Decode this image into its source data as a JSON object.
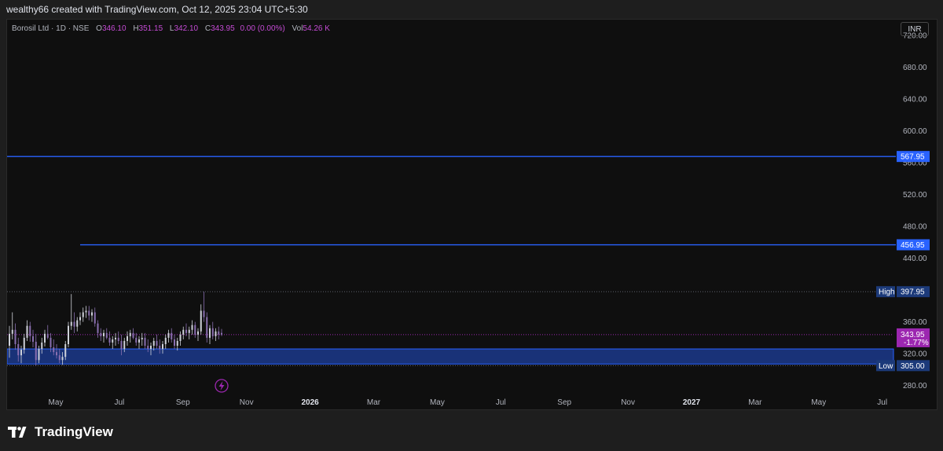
{
  "caption": "wealthy66 created with TradingView.com, Oct 12, 2025 23:04 UTC+5:30",
  "legend": {
    "symbol": "Borosil Ltd · 1D · NSE",
    "open_label": "O",
    "open": "346.10",
    "high_label": "H",
    "high": "351.15",
    "low_label": "L",
    "low": "342.10",
    "close_label": "C",
    "close": "343.95",
    "change": "0.00 (0.00%)",
    "vol_label": "Vol",
    "vol": "54.26 K"
  },
  "currency": "INR",
  "brand": "TradingView",
  "colors": {
    "accent_blue": "#2962ff",
    "purple": "#9c27b0",
    "label_navy": "#1c3a7a",
    "zone_fill": "#1d3f9c"
  },
  "chart_data": {
    "type": "candlestick",
    "ylim": [
      250,
      740
    ],
    "y_ticks": [
      720,
      680,
      640,
      600,
      560,
      520,
      480,
      440,
      360,
      320,
      280
    ],
    "y_tick_labels": [
      "720.00",
      "680.00",
      "640.00",
      "600.00",
      "560.00",
      "520.00",
      "480.00",
      "440.00",
      "360.00",
      "320.00",
      "280.00"
    ],
    "x_ticks": [
      {
        "label": "May",
        "year": false
      },
      {
        "label": "Jul",
        "year": false
      },
      {
        "label": "Sep",
        "year": false
      },
      {
        "label": "Nov",
        "year": false
      },
      {
        "label": "2026",
        "year": true
      },
      {
        "label": "Mar",
        "year": false
      },
      {
        "label": "May",
        "year": false
      },
      {
        "label": "Jul",
        "year": false
      },
      {
        "label": "Sep",
        "year": false
      },
      {
        "label": "Nov",
        "year": false
      },
      {
        "label": "2027",
        "year": true
      },
      {
        "label": "Mar",
        "year": false
      },
      {
        "label": "May",
        "year": false
      },
      {
        "label": "Jul",
        "year": false
      }
    ],
    "horizontal_lines": [
      {
        "value": 567.95,
        "label": "567.95",
        "extends_from_start": true
      },
      {
        "value": 456.95,
        "label": "456.95",
        "extends_from_start": false
      }
    ],
    "high": {
      "label": "High",
      "value": "397.95",
      "y": 397.95
    },
    "low": {
      "label": "Low",
      "value": "305.00",
      "y": 305.0
    },
    "last_price": {
      "value": "343.95",
      "change": "-1.77%",
      "y": 343.95
    },
    "support_zone": [
      307,
      326
    ],
    "candles": [
      [
        330,
        355,
        315,
        345
      ],
      [
        345,
        372,
        338,
        350
      ],
      [
        350,
        358,
        325,
        332
      ],
      [
        332,
        340,
        310,
        318
      ],
      [
        318,
        330,
        308,
        325
      ],
      [
        325,
        345,
        320,
        340
      ],
      [
        340,
        362,
        336,
        355
      ],
      [
        355,
        360,
        335,
        342
      ],
      [
        342,
        350,
        328,
        335
      ],
      [
        335,
        345,
        305,
        312
      ],
      [
        312,
        330,
        308,
        326
      ],
      [
        326,
        340,
        320,
        334
      ],
      [
        334,
        350,
        329,
        345
      ],
      [
        345,
        356,
        338,
        340
      ],
      [
        340,
        346,
        322,
        328
      ],
      [
        328,
        338,
        318,
        322
      ],
      [
        322,
        332,
        314,
        318
      ],
      [
        318,
        326,
        308,
        312
      ],
      [
        312,
        322,
        306,
        316
      ],
      [
        316,
        336,
        312,
        332
      ],
      [
        332,
        360,
        328,
        355
      ],
      [
        355,
        395,
        350,
        360
      ],
      [
        360,
        372,
        346,
        354
      ],
      [
        354,
        366,
        348,
        362
      ],
      [
        362,
        372,
        356,
        366
      ],
      [
        366,
        378,
        360,
        372
      ],
      [
        372,
        380,
        365,
        374
      ],
      [
        374,
        380,
        362,
        368
      ],
      [
        368,
        376,
        360,
        372
      ],
      [
        372,
        378,
        354,
        358
      ],
      [
        358,
        362,
        340,
        346
      ],
      [
        346,
        352,
        336,
        342
      ],
      [
        342,
        350,
        334,
        346
      ],
      [
        346,
        352,
        338,
        340
      ],
      [
        340,
        348,
        330,
        334
      ],
      [
        334,
        342,
        326,
        338
      ],
      [
        338,
        346,
        330,
        340
      ],
      [
        340,
        348,
        332,
        336
      ],
      [
        336,
        344,
        318,
        326
      ],
      [
        326,
        340,
        322,
        336
      ],
      [
        336,
        348,
        330,
        342
      ],
      [
        342,
        350,
        334,
        346
      ],
      [
        346,
        352,
        338,
        340
      ],
      [
        340,
        346,
        330,
        334
      ],
      [
        334,
        342,
        326,
        338
      ],
      [
        338,
        346,
        330,
        340
      ],
      [
        340,
        346,
        326,
        330
      ],
      [
        330,
        338,
        322,
        326
      ],
      [
        326,
        334,
        318,
        330
      ],
      [
        330,
        340,
        324,
        336
      ],
      [
        336,
        344,
        326,
        330
      ],
      [
        330,
        338,
        320,
        326
      ],
      [
        326,
        336,
        320,
        332
      ],
      [
        332,
        344,
        326,
        340
      ],
      [
        340,
        350,
        334,
        346
      ],
      [
        346,
        352,
        334,
        338
      ],
      [
        338,
        344,
        326,
        330
      ],
      [
        330,
        340,
        324,
        336
      ],
      [
        336,
        348,
        330,
        344
      ],
      [
        344,
        354,
        338,
        350
      ],
      [
        350,
        358,
        342,
        346
      ],
      [
        346,
        354,
        338,
        350
      ],
      [
        350,
        362,
        344,
        356
      ],
      [
        356,
        360,
        340,
        344
      ],
      [
        344,
        352,
        336,
        348
      ],
      [
        348,
        382,
        344,
        374
      ],
      [
        374,
        397.95,
        360,
        366
      ],
      [
        366,
        372,
        334,
        340
      ],
      [
        340,
        356,
        332,
        352
      ],
      [
        352,
        360,
        338,
        342
      ],
      [
        342,
        352,
        336,
        348
      ],
      [
        348,
        354,
        338,
        344
      ],
      [
        346.1,
        351.15,
        342.1,
        343.95
      ]
    ]
  }
}
